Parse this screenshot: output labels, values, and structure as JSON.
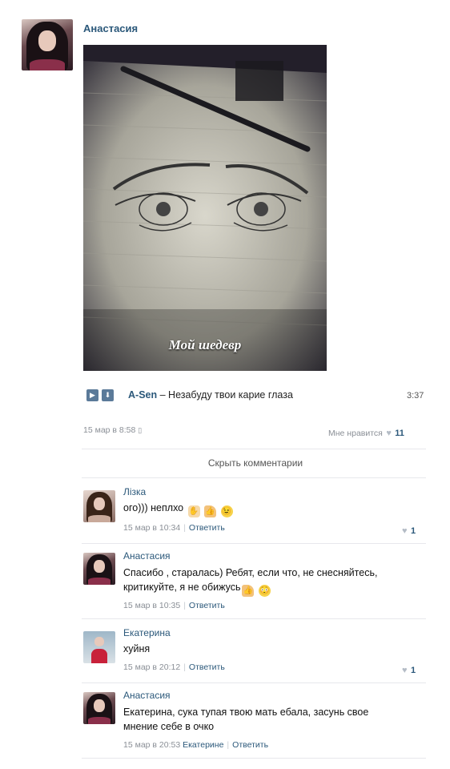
{
  "post": {
    "author": "Анастасия",
    "photo_caption": "Мой шедевр",
    "audio": {
      "artist": "A-Sen",
      "dash": "–",
      "title": "Незабуду твои карие глаза",
      "duration": "3:37"
    },
    "timestamp": "15 мар в 8:58",
    "likes_label": "Мне нравится",
    "likes_count": "11",
    "hide_comments_label": "Скрыть комментарии"
  },
  "comments": [
    {
      "author": "Лізка",
      "text": "ого))) неплхо",
      "date": "15 мар в 10:34",
      "reply": "Ответить",
      "likes": "1",
      "emojis": [
        "clap-emoji",
        "thumbs-up-emoji",
        "wink-emoji"
      ]
    },
    {
      "author": "Анастасия",
      "text_line1": "Спасибо , старалась) Ребят, если что, не снесняйтесь,",
      "text_line2": "критикуйте, я не обижусь",
      "date": "15 мар в 10:35",
      "reply": "Ответить",
      "emojis": [
        "thumbs-up-emoji",
        "flushed-emoji"
      ]
    },
    {
      "author": "Екатерина",
      "text": "хуйня",
      "date": "15 мар в 20:12",
      "reply": "Ответить",
      "likes": "1"
    },
    {
      "author": "Анастасия",
      "text_line1": "Екатерина, сука тупая твою мать ебала, засунь свое",
      "text_line2": "мнение себе в очко",
      "date": "15 мар в 20:53",
      "reply_to": "Екатерине",
      "reply": "Ответить"
    }
  ],
  "colors": {
    "link": "#2b587a",
    "meta": "#8a8f96",
    "divider": "#e7e8ec",
    "audio_button": "#5b7a99"
  }
}
